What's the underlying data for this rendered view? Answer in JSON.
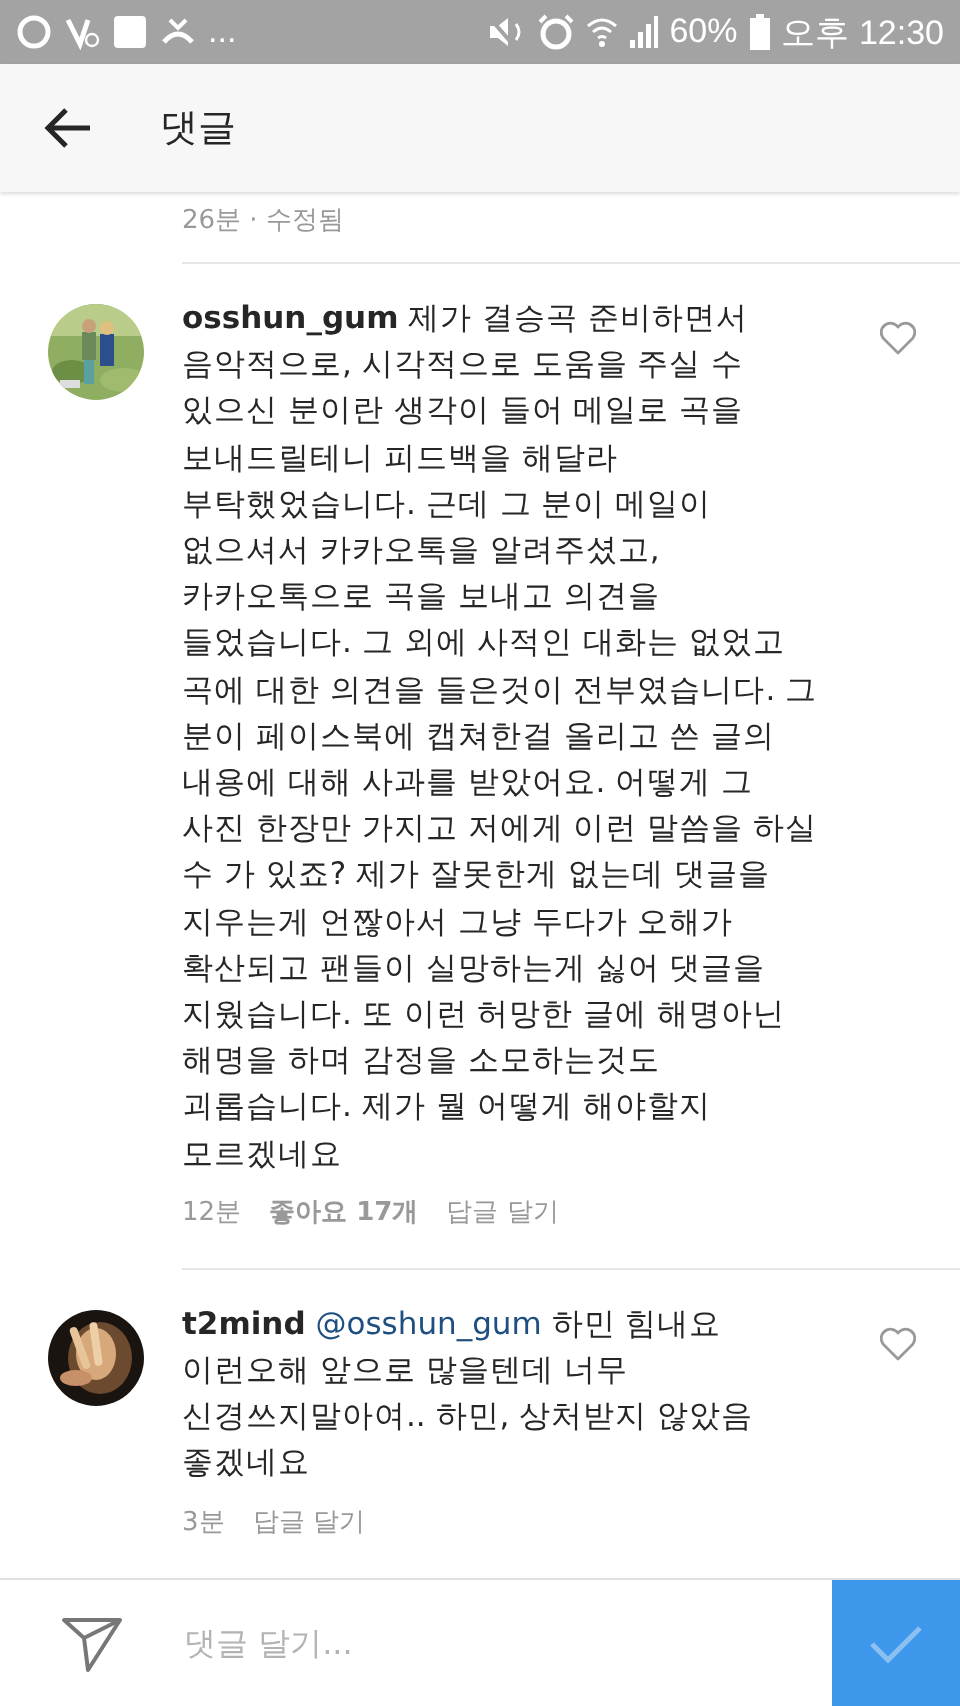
{
  "status_bar": {
    "more": "...",
    "battery": "60%",
    "time": "오후 12:30"
  },
  "app_bar": {
    "title": "댓글"
  },
  "previous_meta": "26분 · 수정됨",
  "comments": [
    {
      "username": "osshun_gum",
      "text": "제가 결승곡 준비하면서\n음악적으로, 시각적으로 도움을 주실 수\n있으신 분이란 생각이 들어 메일로 곡을\n보내드릴테니 피드백을 해달라\n부탁했었습니다. 근데 그 분이 메일이\n없으셔서 카카오톡을 알려주셨고,\n카카오톡으로 곡을 보내고 의견을\n들었습니다. 그 외에 사적인 대화는 없었고\n곡에 대한 의견을 들은것이 전부였습니다. 그\n분이 페이스북에 캡쳐한걸 올리고 쓴 글의\n내용에 대해 사과를 받았어요. 어떻게 그\n사진 한장만 가지고 저에게 이런 말씀을 하실\n수 가 있죠? 제가 잘못한게 없는데 댓글을\n지우는게 언짢아서 그냥 두다가 오해가\n확산되고 팬들이 실망하는게 싫어 댓글을\n지웠습니다. 또 이런 허망한 글에 해명아닌\n해명을 하며 감정을 소모하는것도\n괴롭습니다. 제가 뭘 어떻게 해야할지\n모르겠네요",
      "time": "12분",
      "likes": "좋아요 17개",
      "reply": "답글 달기"
    },
    {
      "username": "t2mind",
      "mention": "@osshun_gum",
      "text": "하민 힘내요\n이런오해 앞으로 많을텐데 너무\n신경쓰지말아여.. 하민, 상처받지 않았음\n좋겠네요",
      "time": "3분",
      "reply": "답글 달기"
    }
  ],
  "composer": {
    "placeholder": "댓글 달기..."
  }
}
